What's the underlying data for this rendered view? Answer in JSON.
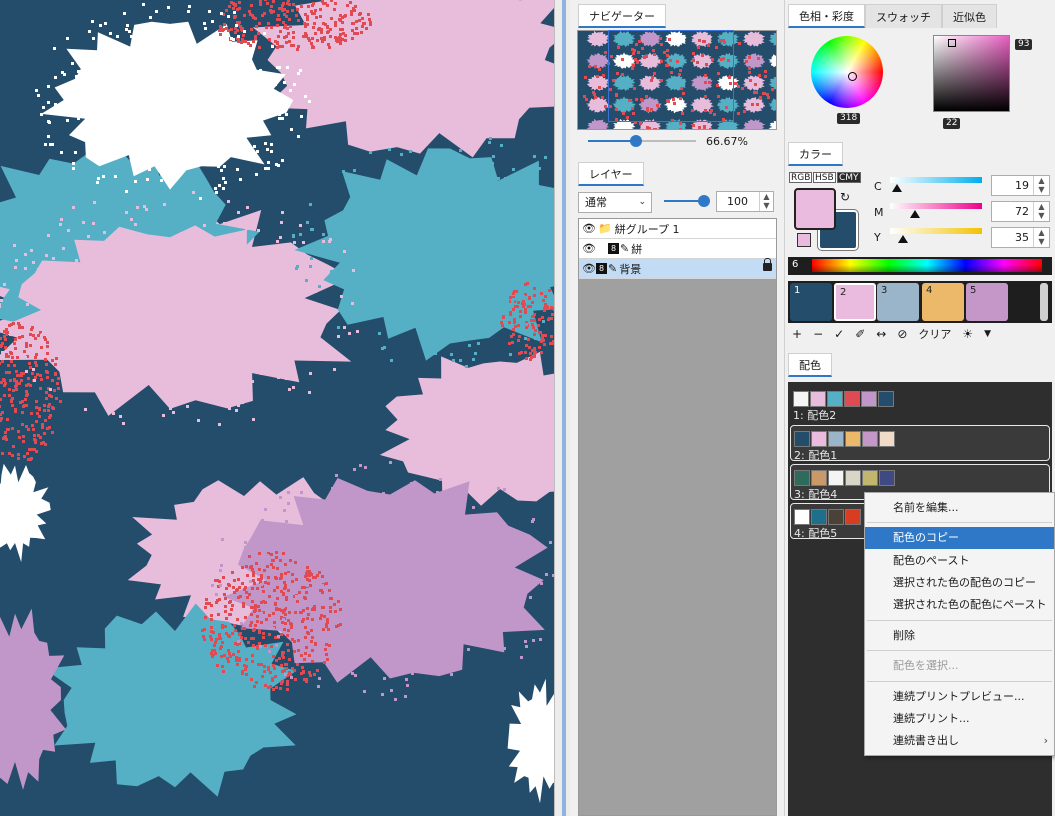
{
  "canvas": {
    "colors": {
      "navy": "#244c6b",
      "pink": "#e8bddc",
      "teal": "#55b0c5",
      "purple": "#c197c9",
      "white": "#ffffff",
      "red": "#e04a52"
    }
  },
  "navigator": {
    "tab_label": "ナビゲーター",
    "zoom": "66.67%",
    "zoom_value": 0.44
  },
  "layers": {
    "tab_label": "レイヤー",
    "blend_mode": "通常",
    "opacity": "100",
    "opacity_value": 1.0,
    "rows": [
      {
        "name": "絣グループ 1",
        "eye_icon": "eye-icon",
        "type_icon": "folder-icon",
        "selected": false
      },
      {
        "name": "絣",
        "eye_icon": "eye-icon",
        "type_icon": "pen-icon",
        "bit_badge": "8",
        "selected": false
      },
      {
        "name": "背景",
        "eye_icon": "eye-icon",
        "type_icon": "pen-icon",
        "bit_badge": "8",
        "selected": true,
        "locked": true
      }
    ]
  },
  "color_panel": {
    "tabs": [
      "色相・彩度",
      "スウォッチ",
      "近似色"
    ],
    "active_tab": 0,
    "hue_value": "318",
    "saturation_value": "93",
    "value_value": "22"
  },
  "color_mixer": {
    "tab_label": "カラー",
    "modes": [
      "RGB",
      "HSB",
      "CMY"
    ],
    "active_mode": "CMY",
    "foreground": "#ebbadf",
    "background": "#244c6b",
    "channels": [
      {
        "label": "C",
        "value": "19"
      },
      {
        "label": "M",
        "value": "72"
      },
      {
        "label": "Y",
        "value": "35"
      }
    ],
    "palette_count": "6",
    "swatches": [
      {
        "label": "1",
        "color": "#244c6b"
      },
      {
        "label": "2",
        "color": "#ebbadf"
      },
      {
        "label": "3",
        "color": "#9ab4c9"
      },
      {
        "label": "4",
        "color": "#ecb96a"
      },
      {
        "label": "5",
        "color": "#c497c8"
      }
    ],
    "tool_icons": [
      "plus-icon",
      "minus-icon",
      "check-icon",
      "dropper-icon",
      "swap-icon",
      "no-icon"
    ],
    "clear_label": "クリア"
  },
  "harmony": {
    "tab_label": "配色",
    "items": [
      {
        "name": "1: 配色2",
        "colors": [
          "#f5f5f5",
          "#e8bddc",
          "#55b0c5",
          "#e04a52",
          "#c197c9",
          "#244c6b"
        ]
      },
      {
        "name": "2: 配色1",
        "colors": [
          "#244c6b",
          "#ebbadf",
          "#9ab4c9",
          "#ecb96a",
          "#c497c8",
          "#f0dcc6"
        ]
      },
      {
        "name": "3: 配色4",
        "colors": [
          "#2f6b5c",
          "#c99968",
          "#f4f4f4",
          "#d9d6c7",
          "#c2b56d",
          "#3f4a84"
        ]
      },
      {
        "name": "4: 配色5",
        "colors": [
          "#ffffff",
          "#1d6f8c",
          "#4a4238",
          "#d93d21"
        ]
      }
    ]
  },
  "context_menu": {
    "items": [
      {
        "label": "名前を編集...",
        "disabled": false
      },
      {
        "label": "配色のコピー",
        "highlighted": true
      },
      {
        "label": "配色のペースト"
      },
      {
        "label": "選択された色の配色のコピー"
      },
      {
        "label": "選択された色の配色にペースト"
      },
      {
        "label": "削除"
      },
      {
        "label": "配色を選択...",
        "disabled": true
      },
      {
        "label": "連続プリントプレビュー..."
      },
      {
        "label": "連続プリント..."
      },
      {
        "label": "連続書き出し",
        "submenu": true
      }
    ]
  }
}
